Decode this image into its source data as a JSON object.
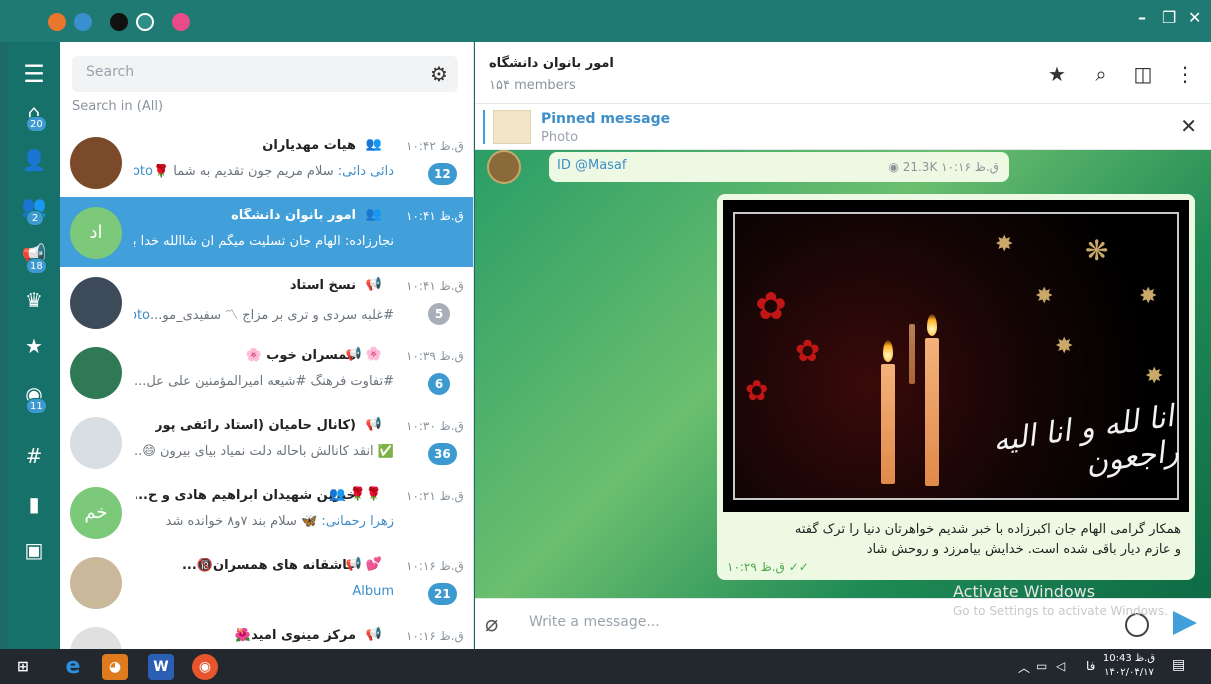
{
  "window": {
    "dots": [
      "#e8762d",
      "#3a8fcf",
      "#111111",
      "#2f8f87",
      "#e84a8a"
    ],
    "minimize": "–",
    "restore": "❐",
    "close": "✕"
  },
  "rail": {
    "menu_icon": "☰",
    "items": [
      {
        "icon": "home-icon",
        "glyph": "⌂",
        "badge": "20"
      },
      {
        "icon": "user-icon",
        "glyph": "👤",
        "badge": ""
      },
      {
        "icon": "group-icon",
        "glyph": "👥",
        "badge": "2"
      },
      {
        "icon": "megaphone-icon",
        "glyph": "📢",
        "badge": "18"
      },
      {
        "icon": "crown-icon",
        "glyph": "♛",
        "badge": ""
      },
      {
        "icon": "star-icon",
        "glyph": "★",
        "badge": ""
      },
      {
        "icon": "eye-icon",
        "glyph": "◉",
        "badge": "11"
      },
      {
        "icon": "hashtag-icon",
        "glyph": "#",
        "badge": ""
      },
      {
        "icon": "bookmark-icon",
        "glyph": "▮",
        "badge": ""
      },
      {
        "icon": "contact-icon",
        "glyph": "▣",
        "badge": ""
      }
    ]
  },
  "search": {
    "placeholder": "Search",
    "search_in": "Search in (All)"
  },
  "chats": [
    {
      "name": "هیات مهدیاران",
      "icons": "👥",
      "time": "ق.ظ ۱۰:۴۲",
      "preview_hl": "Photo, ",
      "preview": "سلام مریم جون تقدیم به شما 🌹",
      "preview_hl2": "دائی دائی:",
      "badge": "12",
      "muted": false,
      "avatar_color": "#7a4a2a",
      "avatar_text": ""
    },
    {
      "name": "امور بانوان دانشگاه",
      "icons": "👥",
      "time": "ق.ظ ۱۰:۴۱",
      "preview_hl": "",
      "preview": "نجارزاده: الهام جان تسلیت میگم ان شاالله خدا بهتون صبر...",
      "preview_hl2": "",
      "badge": "",
      "muted": false,
      "avatar_color": "#7cc97a",
      "avatar_text": "اد"
    },
    {
      "name": "نسخ استاد",
      "icons": "📢",
      "time": "ق.ظ ۱۰:۴۱",
      "preview_hl": "Photo, ",
      "preview": "#غلبه سردی و تری بر مزاج 〽 سفیدی_مو...",
      "preview_hl2": "",
      "badge": "5",
      "muted": true,
      "avatar_color": "#3c4a5a",
      "avatar_text": ""
    },
    {
      "name": "همسران خوب 🌸",
      "icons": "📢 🌸",
      "time": "ق.ظ ۱۰:۳۹",
      "preview_hl": "Photo, ",
      "preview": "#تفاوت فرهنگ #شیعه امیرالمؤمنین علی عل...",
      "preview_hl2": "",
      "badge": "6",
      "muted": false,
      "avatar_color": "#2f7a55",
      "avatar_text": ""
    },
    {
      "name": "(کانال حامیان (استاد رائفی پور",
      "icons": "📢",
      "time": "ق.ظ ۱۰:۳۰",
      "preview_hl": "",
      "preview": "✅ انقد کانالش باحاله دلت نمیاد بیای بیرون 😄...",
      "preview_hl2": "",
      "badge": "36",
      "muted": false,
      "avatar_color": "#d8dee3",
      "avatar_text": ""
    },
    {
      "name": "خیرین شهیدان ابراهیم هادی و ح...",
      "icons": "👥 🌹🌹",
      "time": "ق.ظ ۱۰:۲۱",
      "preview_hl": "",
      "preview": "سلام  بند ۷و۸ خوانده شد",
      "preview_hl2": "زهرا رحمانی: 🦋",
      "badge": "",
      "muted": false,
      "avatar_color": "#7cc97a",
      "avatar_text": "خم"
    },
    {
      "name": "عاشقانه های همسران🔞...",
      "icons": "📢 💕",
      "time": "ق.ظ ۱۰:۱۶",
      "preview_hl": "Album",
      "preview": "",
      "preview_hl2": "",
      "badge": "21",
      "muted": false,
      "avatar_color": "#c9b89a",
      "avatar_text": ""
    },
    {
      "name": "مرکز مینوی امید🌺",
      "icons": "📢",
      "time": "ق.ظ ۱۰:۱۶",
      "preview_hl": "",
      "preview": "",
      "preview_hl2": "",
      "badge": "",
      "muted": false,
      "avatar_color": "#e0e0e0",
      "avatar_text": ""
    }
  ],
  "chat": {
    "title": "امور بانوان دانشگاه",
    "members": "۱۵۴ members",
    "pinned_title": "Pinned message",
    "pinned_sub": "Photo",
    "forward_id": "ID @Masaf",
    "forward_meta": "◉ 21.3K  ق.ظ ۱۰:۱۶",
    "calligraphy": "انا لله و انا الیه راجعون",
    "caption_line1": "همکار گرامی الهام جان اکبرزاده با خبر شدیم خواهرتان دنیا را ترک گفته",
    "caption_line2": "و عازم دیار باقی شده است. خدایش بیامرزد و روحش شاد",
    "msg_time": "ق.ظ ۱۰:۲۹ ✓✓",
    "input_placeholder": "Write a message..."
  },
  "watermark": {
    "line1": "Activate Windows",
    "line2": "Go to Settings to activate Windows."
  },
  "taskbar": {
    "lang": "فا",
    "time": "10:43 ق.ظ",
    "date": "۱۴۰۲/۰۴/۱۷"
  }
}
